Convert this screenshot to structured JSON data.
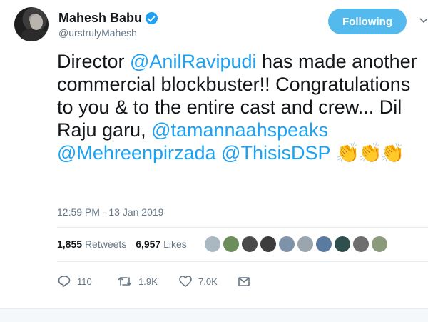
{
  "user": {
    "display_name": "Mahesh Babu",
    "handle": "@urstrulyMahesh",
    "verified": true
  },
  "follow_button": {
    "label": "Following"
  },
  "tweet": {
    "text_before": "Director ",
    "mention_1": "@AnilRavipudi",
    "text_middle": " has made another commercial blockbuster!! Congratulations to you & to the entire cast and crew... Dil Raju garu, ",
    "mention_2": "@tamannaahspeaks",
    "mention_3": "@Mehreenpirzada",
    "mention_4": "@ThisisDSP",
    "emojis": "👏👏👏",
    "timestamp": "12:59 PM - 13 Jan 2019"
  },
  "stats": {
    "retweets_count": "1,855",
    "retweets_label": "Retweets",
    "likes_count": "6,957",
    "likes_label": "Likes"
  },
  "likers": {
    "count": 10,
    "colors": [
      "#aab8c2",
      "#6b8e5a",
      "#4a4a4a",
      "#3d3d3d",
      "#7f93a8",
      "#9aa5ae",
      "#5b7aa0",
      "#2f4f4f",
      "#6e6e6e",
      "#8a9a7a"
    ]
  },
  "actions": {
    "reply_icon": "reply-icon",
    "reply_count": "110",
    "retweet_icon": "retweet-icon",
    "retweet_count": "1.9K",
    "like_icon": "heart-icon",
    "like_count": "7.0K",
    "message_icon": "envelope-icon"
  },
  "colors": {
    "accent": "#1da1f2",
    "follow_button": "#54b9ec",
    "secondary_text": "#657786",
    "primary_text": "#14171a"
  }
}
